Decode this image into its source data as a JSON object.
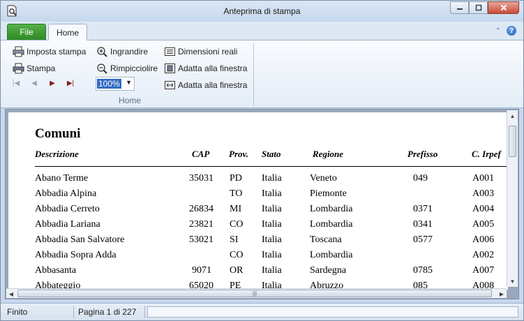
{
  "window": {
    "title": "Anteprima di stampa"
  },
  "ribbon": {
    "tabs": [
      {
        "label": "File"
      },
      {
        "label": "Home"
      }
    ],
    "items": {
      "page_setup": "Imposta stampa",
      "print": "Stampa",
      "zoom_in": "Ingrandire",
      "zoom_out": "Rimpicciolire",
      "actual_size": "Dimensioni reali",
      "fit_window_1": "Adatta alla finestra",
      "fit_window_2": "Adatta alla finestra"
    },
    "zoom_value": "100%",
    "group_label": "Home",
    "help_label": "?"
  },
  "report": {
    "title": "Comuni",
    "columns": [
      "Descrizione",
      "CAP",
      "Prov.",
      "Stato",
      "Regione",
      "Prefisso",
      "C. Irpef"
    ],
    "rows": [
      [
        "Abano Terme",
        "35031",
        "PD",
        "Italia",
        "Veneto",
        "049",
        "A001"
      ],
      [
        "Abbadia Alpina",
        "",
        "TO",
        "Italia",
        "Piemonte",
        "",
        "A003"
      ],
      [
        "Abbadia Cerreto",
        "26834",
        "MI",
        "Italia",
        "Lombardia",
        "0371",
        "A004"
      ],
      [
        "Abbadia Lariana",
        "23821",
        "CO",
        "Italia",
        "Lombardia",
        "0341",
        "A005"
      ],
      [
        "Abbadia San Salvatore",
        "53021",
        "SI",
        "Italia",
        "Toscana",
        "0577",
        "A006"
      ],
      [
        "Abbadia Sopra Adda",
        "",
        "CO",
        "Italia",
        "Lombardia",
        "",
        "A002"
      ],
      [
        "Abbasanta",
        "9071",
        "OR",
        "Italia",
        "Sardegna",
        "0785",
        "A007"
      ],
      [
        "Abbateggio",
        "65020",
        "PE",
        "Italia",
        "Abruzzo",
        "085",
        "A008"
      ]
    ]
  },
  "status": {
    "state": "Finito",
    "page": "Pagina 1 di 227"
  }
}
